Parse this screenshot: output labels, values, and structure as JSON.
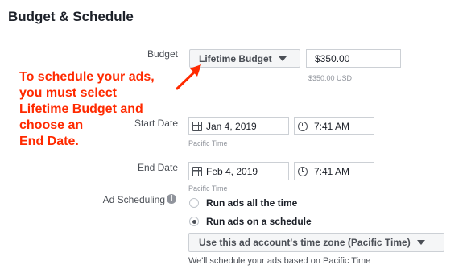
{
  "header": {
    "title": "Budget & Schedule"
  },
  "budget": {
    "label": "Budget",
    "type_button": "Lifetime Budget",
    "amount_value": "$350.00",
    "amount_note": "$350.00 USD"
  },
  "start": {
    "label": "Start Date",
    "date": "Jan 4, 2019",
    "time": "7:41 AM",
    "timezone_note": "Pacific Time"
  },
  "end": {
    "label": "End Date",
    "date": "Feb 4, 2019",
    "time": "7:41 AM",
    "timezone_note": "Pacific Time"
  },
  "scheduling": {
    "label": "Ad Scheduling",
    "info_glyph": "i",
    "option_all": "Run ads all the time",
    "option_schedule": "Run ads on a schedule",
    "selected": "Run ads on a schedule",
    "timezone_button": "Use this ad account's time zone (Pacific Time)",
    "footnote": "We'll schedule your ads based on Pacific Time"
  },
  "annotation": {
    "text_lines": [
      "To schedule your ads,",
      "you must select",
      "Lifetime Budget and",
      "choose an",
      "End Date."
    ],
    "color": "#ff2a00"
  },
  "icons": {
    "calendar": "calendar-icon",
    "clock": "clock-icon",
    "caret": "caret-down-icon",
    "info": "info-icon"
  }
}
